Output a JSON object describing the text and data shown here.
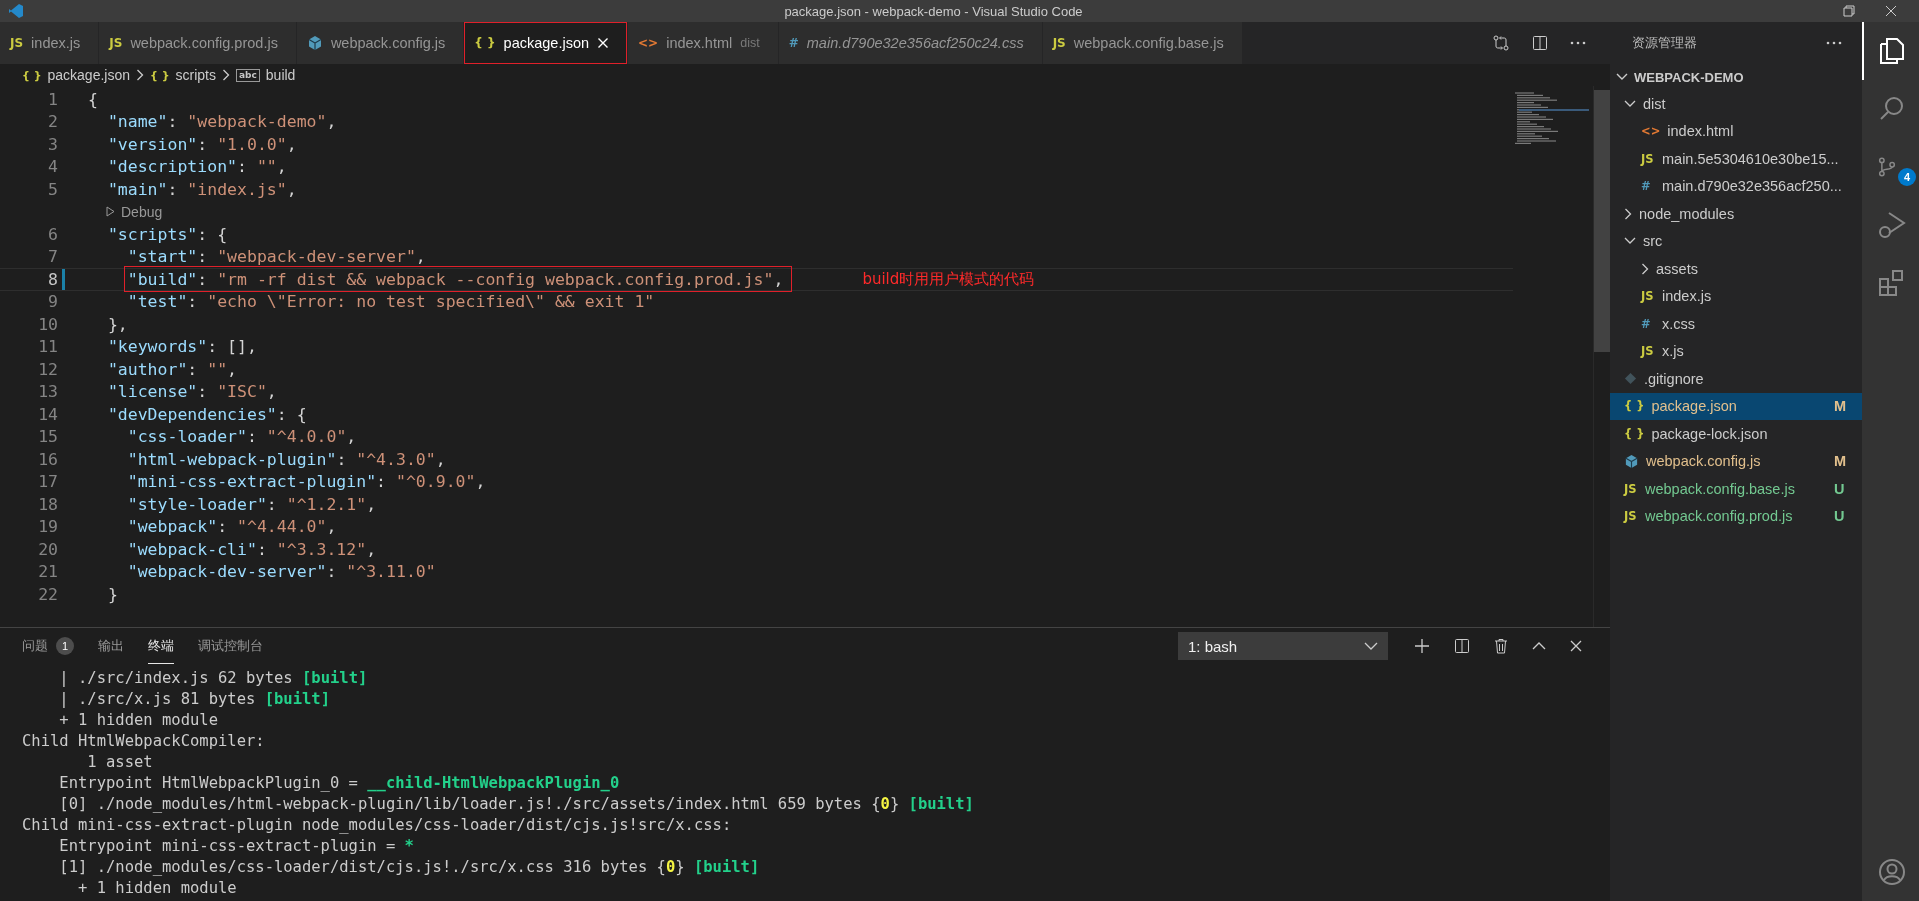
{
  "window": {
    "title": "package.json - webpack-demo - Visual Studio Code"
  },
  "tabs": [
    {
      "glyph": "JS",
      "kind": "js",
      "label": "index.js",
      "selected": false,
      "preview": false
    },
    {
      "glyph": "JS",
      "kind": "js",
      "label": "webpack.config.prod.js",
      "selected": false,
      "preview": false
    },
    {
      "kind": "webpack",
      "label": "webpack.config.js",
      "selected": false,
      "preview": false
    },
    {
      "glyph": "{ }",
      "kind": "json",
      "label": "package.json",
      "selected": true,
      "preview": false,
      "annotated": true
    },
    {
      "glyph": "<>",
      "kind": "html",
      "label": "index.html",
      "description": "dist",
      "selected": false,
      "preview": false
    },
    {
      "glyph": "#",
      "kind": "css",
      "label": "main.d790e32e356acf250c24.css",
      "selected": false,
      "preview": true
    },
    {
      "glyph": "JS",
      "kind": "js",
      "label": "webpack.config.base.js",
      "selected": false,
      "preview": false
    }
  ],
  "breadcrumbs": [
    {
      "glyph": "{ }",
      "kind": "json",
      "label": "package.json"
    },
    {
      "glyph": "{ }",
      "kind": "object",
      "label": "scripts"
    },
    {
      "glyph": "abc",
      "kind": "string",
      "label": "build"
    }
  ],
  "editor": {
    "lines": [
      {
        "kind": "code",
        "number": "1",
        "text": "{",
        "current": false,
        "modified": false
      },
      {
        "kind": "code",
        "number": "2",
        "text": "  \"name\": \"webpack-demo\",",
        "current": false,
        "modified": false
      },
      {
        "kind": "code",
        "number": "3",
        "text": "  \"version\": \"1.0.0\",",
        "current": false,
        "modified": false
      },
      {
        "kind": "code",
        "number": "4",
        "text": "  \"description\": \"\",",
        "current": false,
        "modified": false
      },
      {
        "kind": "code",
        "number": "5",
        "text": "  \"main\": \"index.js\",",
        "current": false,
        "modified": false
      },
      {
        "kind": "codelens",
        "text": "Debug"
      },
      {
        "kind": "code",
        "number": "6",
        "text": "  \"scripts\": {",
        "current": false,
        "modified": false
      },
      {
        "kind": "code",
        "number": "7",
        "text": "    \"start\": \"webpack-dev-server\",",
        "current": false,
        "modified": false
      },
      {
        "kind": "code",
        "number": "8",
        "text": "    \"build\": \"rm -rf dist && webpack --config webpack.config.prod.js\",",
        "current": true,
        "modified": true,
        "annotation": "build时用用户模式的代码"
      },
      {
        "kind": "code",
        "number": "9",
        "text": "    \"test\": \"echo \\\"Error: no test specified\\\" && exit 1\"",
        "current": false,
        "modified": false
      },
      {
        "kind": "code",
        "number": "10",
        "text": "  },",
        "current": false,
        "modified": false
      },
      {
        "kind": "code",
        "number": "11",
        "text": "  \"keywords\": [],",
        "current": false,
        "modified": false
      },
      {
        "kind": "code",
        "number": "12",
        "text": "  \"author\": \"\",",
        "current": false,
        "modified": false
      },
      {
        "kind": "code",
        "number": "13",
        "text": "  \"license\": \"ISC\",",
        "current": false,
        "modified": false
      },
      {
        "kind": "code",
        "number": "14",
        "text": "  \"devDependencies\": {",
        "current": false,
        "modified": false
      },
      {
        "kind": "code",
        "number": "15",
        "text": "    \"css-loader\": \"^4.0.0\",",
        "current": false,
        "modified": false
      },
      {
        "kind": "code",
        "number": "16",
        "text": "    \"html-webpack-plugin\": \"^4.3.0\",",
        "current": false,
        "modified": false
      },
      {
        "kind": "code",
        "number": "17",
        "text": "    \"mini-css-extract-plugin\": \"^0.9.0\",",
        "current": false,
        "modified": false
      },
      {
        "kind": "code",
        "number": "18",
        "text": "    \"style-loader\": \"^1.2.1\",",
        "current": false,
        "modified": false
      },
      {
        "kind": "code",
        "number": "19",
        "text": "    \"webpack\": \"^4.44.0\",",
        "current": false,
        "modified": false
      },
      {
        "kind": "code",
        "number": "20",
        "text": "    \"webpack-cli\": \"^3.3.12\",",
        "current": false,
        "modified": false
      },
      {
        "kind": "code",
        "number": "21",
        "text": "    \"webpack-dev-server\": \"^3.11.0\"",
        "current": false,
        "modified": false
      },
      {
        "kind": "code",
        "number": "22",
        "text": "  }",
        "current": false,
        "modified": false
      }
    ]
  },
  "panel": {
    "tabs": [
      {
        "label": "问题",
        "badge": "1",
        "selected": false
      },
      {
        "label": "输出",
        "selected": false
      },
      {
        "label": "终端",
        "selected": true
      },
      {
        "label": "调试控制台",
        "selected": false
      }
    ],
    "terminal_dropdown": "1: bash",
    "terminal_lines": [
      {
        "segments": [
          {
            "text": "    | ./src/index.js 62 bytes "
          },
          {
            "text": "[built]",
            "color": "#23d18b"
          }
        ]
      },
      {
        "segments": [
          {
            "text": "    | ./src/x.js 81 bytes "
          },
          {
            "text": "[built]",
            "color": "#23d18b"
          }
        ]
      },
      {
        "segments": [
          {
            "text": "    + 1 hidden module"
          }
        ]
      },
      {
        "segments": [
          {
            "text": "Child HtmlWebpackCompiler:"
          }
        ]
      },
      {
        "segments": [
          {
            "text": "       1 asset"
          }
        ]
      },
      {
        "segments": [
          {
            "text": "    Entrypoint HtmlWebpackPlugin_0 = "
          },
          {
            "text": "__child-HtmlWebpackPlugin_0",
            "color": "#23d18b"
          }
        ]
      },
      {
        "segments": [
          {
            "text": "    [0] ./node_modules/html-webpack-plugin/lib/loader.js!./src/assets/index.html 659 bytes {"
          },
          {
            "text": "0",
            "color": "#f5f543"
          },
          {
            "text": "} "
          },
          {
            "text": "[built]",
            "color": "#23d18b"
          }
        ]
      },
      {
        "segments": [
          {
            "text": "Child mini-css-extract-plugin node_modules/css-loader/dist/cjs.js!src/x.css:"
          }
        ]
      },
      {
        "segments": [
          {
            "text": "    Entrypoint mini-css-extract-plugin = "
          },
          {
            "text": "*",
            "color": "#23d18b"
          }
        ]
      },
      {
        "segments": [
          {
            "text": "    [1] ./node_modules/css-loader/dist/cjs.js!./src/x.css 316 bytes {"
          },
          {
            "text": "0",
            "color": "#f5f543"
          },
          {
            "text": "} "
          },
          {
            "text": "[built]",
            "color": "#23d18b"
          }
        ]
      },
      {
        "segments": [
          {
            "text": "      + 1 hidden module"
          }
        ]
      }
    ]
  },
  "sidebar": {
    "title": "资源管理器",
    "section": "WEBPACK-DEMO",
    "tree": {
      "items": [
        {
          "kind": "folder",
          "label": "dist",
          "expanded": true,
          "selected": false,
          "children": [
            {
              "kind": "html",
              "glyph": "<>",
              "label": "index.html",
              "selected": false
            },
            {
              "kind": "js",
              "glyph": "JS",
              "label": "main.5e5304610e30be15...",
              "selected": false
            },
            {
              "kind": "css",
              "glyph": "#",
              "label": "main.d790e32e356acf250...",
              "selected": false
            }
          ]
        },
        {
          "kind": "folder",
          "label": "node_modules",
          "expanded": false,
          "selected": false
        },
        {
          "kind": "folder",
          "label": "src",
          "expanded": true,
          "selected": false,
          "children": [
            {
              "kind": "folder",
              "label": "assets",
              "expanded": false,
              "selected": false
            },
            {
              "kind": "js",
              "glyph": "JS",
              "label": "index.js",
              "selected": false
            },
            {
              "kind": "css",
              "glyph": "#",
              "label": "x.css",
              "selected": false
            },
            {
              "kind": "js",
              "glyph": "JS",
              "label": "x.js",
              "selected": false
            }
          ]
        },
        {
          "kind": "git",
          "label": ".gitignore",
          "selected": false
        },
        {
          "kind": "json",
          "glyph": "{ }",
          "label": "package.json",
          "status": "M",
          "color": "#e2c08d",
          "selected": true
        },
        {
          "kind": "json",
          "glyph": "{ }",
          "label": "package-lock.json",
          "selected": false
        },
        {
          "kind": "webpack",
          "label": "webpack.config.js",
          "status": "M",
          "color": "#e2c08d",
          "selected": false
        },
        {
          "kind": "js",
          "glyph": "JS",
          "label": "webpack.config.base.js",
          "status": "U",
          "color": "#73c991",
          "selected": false
        },
        {
          "kind": "js",
          "glyph": "JS",
          "label": "webpack.config.prod.js",
          "status": "U",
          "color": "#73c991",
          "selected": false
        }
      ]
    }
  },
  "activity_bar": [
    {
      "kind": "explorer",
      "selected": true
    },
    {
      "kind": "search",
      "selected": false
    },
    {
      "kind": "source-control",
      "badge": "4",
      "selected": false
    },
    {
      "kind": "run-debug",
      "selected": false
    },
    {
      "kind": "extensions",
      "selected": false
    },
    {
      "kind": "account",
      "selected": false
    }
  ]
}
